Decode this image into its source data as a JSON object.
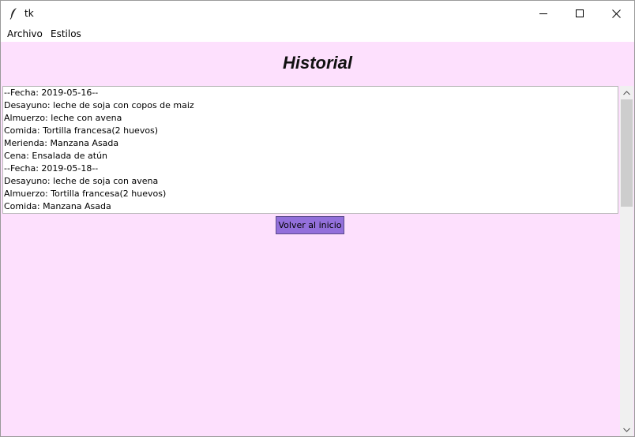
{
  "window": {
    "title": "tk",
    "icon": "feather-icon"
  },
  "menu": {
    "items": [
      "Archivo",
      "Estilos"
    ]
  },
  "main": {
    "heading": "Historial",
    "history_lines": [
      "--Fecha: 2019-05-16--",
      "Desayuno: leche de soja con copos de maiz",
      "Almuerzo: leche con avena",
      "Comida: Tortilla francesa(2 huevos)",
      "Merienda: Manzana Asada",
      "Cena: Ensalada de atún",
      "--Fecha: 2019-05-18--",
      "Desayuno: leche de soja con avena",
      "Almuerzo: Tortilla francesa(2 huevos)",
      "Comida: Manzana Asada"
    ],
    "back_button_label": "Volver al inicio"
  },
  "colors": {
    "background": "#fde0fd",
    "button": "#9370db",
    "scroll_thumb": "#cdcdcd"
  }
}
